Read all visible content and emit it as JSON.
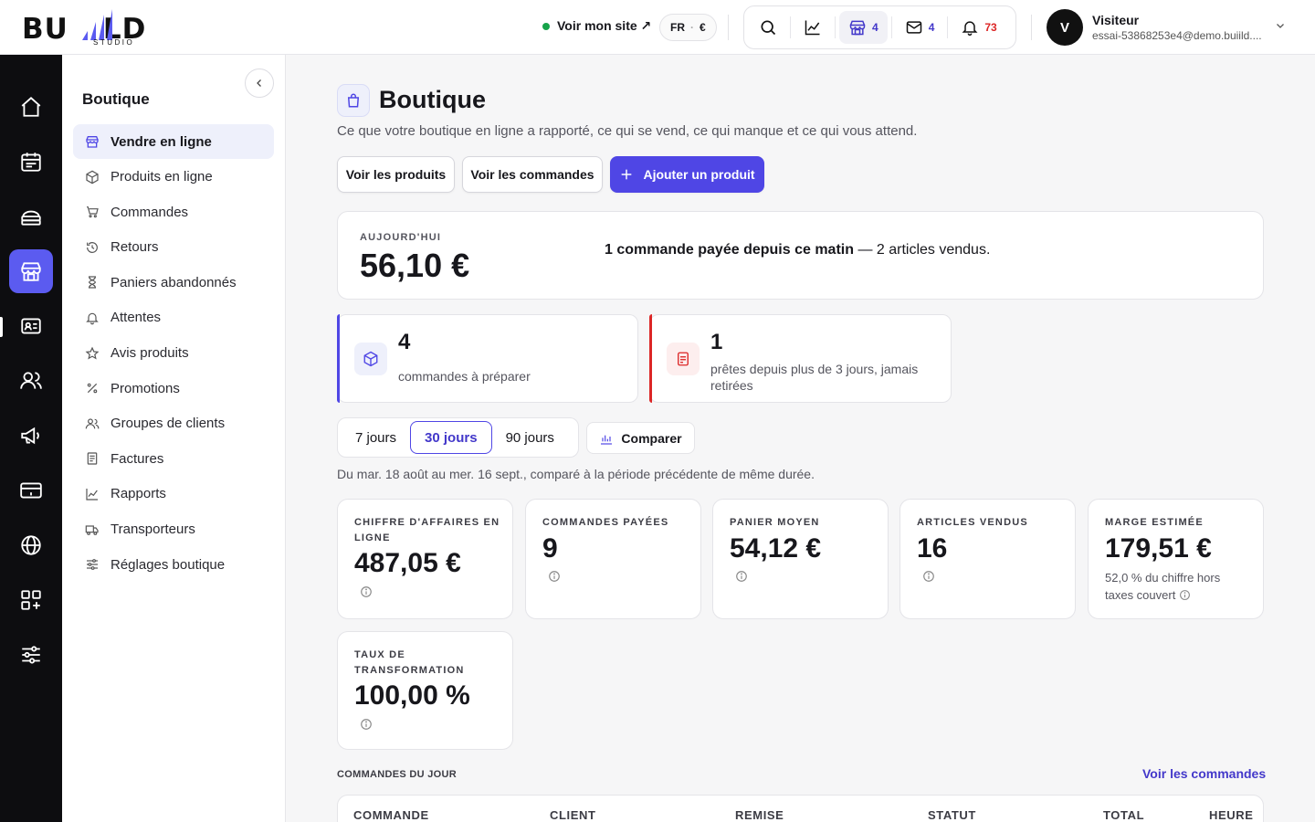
{
  "brand": {
    "name": "BUIILD",
    "sub": "STUDIO"
  },
  "topbar": {
    "site_link": "Voir mon site ↗",
    "lang": "FR",
    "currency": "€",
    "tools": {
      "shop_count": "4",
      "mail_count": "4",
      "notif_count": "73"
    },
    "user": {
      "initial": "V",
      "name": "Visiteur",
      "email": "essai-53868253e4@demo.buiild...."
    }
  },
  "colors": {
    "accent": "#4f46e5",
    "rail": "#0d0d10",
    "danger": "#dc2626",
    "success": "#16a34a"
  },
  "rail": {
    "items": [
      "home-icon",
      "calendar-icon",
      "services-icon",
      "shop-icon",
      "contacts-card-icon",
      "people-icon",
      "megaphone-icon",
      "payment-card-icon",
      "globe-icon",
      "apps-icon",
      "sliders-icon"
    ],
    "active": "shop-icon"
  },
  "sidebar": {
    "title": "Boutique",
    "items": [
      {
        "label": "Vendre en ligne",
        "icon": "storefront-icon"
      },
      {
        "label": "Produits en ligne",
        "icon": "box-icon"
      },
      {
        "label": "Commandes",
        "icon": "cart-icon"
      },
      {
        "label": "Retours",
        "icon": "history-icon"
      },
      {
        "label": "Paniers abandonnés",
        "icon": "hourglass-icon"
      },
      {
        "label": "Attentes",
        "icon": "bell-icon"
      },
      {
        "label": "Avis produits",
        "icon": "star-icon"
      },
      {
        "label": "Promotions",
        "icon": "percent-icon"
      },
      {
        "label": "Groupes de clients",
        "icon": "users-icon"
      },
      {
        "label": "Factures",
        "icon": "invoice-icon"
      },
      {
        "label": "Rapports",
        "icon": "chart-line-icon"
      },
      {
        "label": "Transporteurs",
        "icon": "truck-icon"
      },
      {
        "label": "Réglages boutique",
        "icon": "settings-sliders-icon"
      }
    ]
  },
  "main": {
    "title": "Boutique",
    "subtitle": "Ce que votre boutique en ligne a rapporté, ce qui se vend, ce qui manque et ce qui vous attend.",
    "buttons": {
      "products": "Voir les produits",
      "orders": "Voir les commandes",
      "add": "Ajouter un produit"
    },
    "today": {
      "label": "AUJOURD'HUI",
      "value": "56,10 €",
      "highlight": "1 commande payée depuis ce matin",
      "rest": " — 2 articles vendus."
    },
    "alerts": [
      {
        "count": "4",
        "text": "commandes à préparer"
      },
      {
        "count": "1",
        "text": "prêtes depuis plus de 3 jours, jamais retirées"
      }
    ],
    "ranges": {
      "r7": "7 jours",
      "r30": "30 jours",
      "r90": "90 jours",
      "compare": "Comparer"
    },
    "period": "Du mar. 18 août au mer. 16 sept., comparé à la période précédente de même durée.",
    "kpis": [
      {
        "label": "Chiffre d'affaires en ligne",
        "value": "487,05 €"
      },
      {
        "label": "Commandes payées",
        "value": "9"
      },
      {
        "label": "Panier moyen",
        "value": "54,12 €"
      },
      {
        "label": "Articles vendus",
        "value": "16"
      },
      {
        "label": "Marge estimée",
        "value": "179,51 €",
        "note": "52,0 % du chiffre hors taxes couvert"
      },
      {
        "label": "Taux de transformation",
        "value": "100,00 %"
      }
    ],
    "orders_section": {
      "label": "COMMANDES DU JOUR",
      "link": "Voir les commandes"
    },
    "table": {
      "headers": [
        "COMMANDE",
        "CLIENT",
        "REMISE",
        "STATUT",
        "TOTAL",
        "HEURE"
      ]
    }
  }
}
